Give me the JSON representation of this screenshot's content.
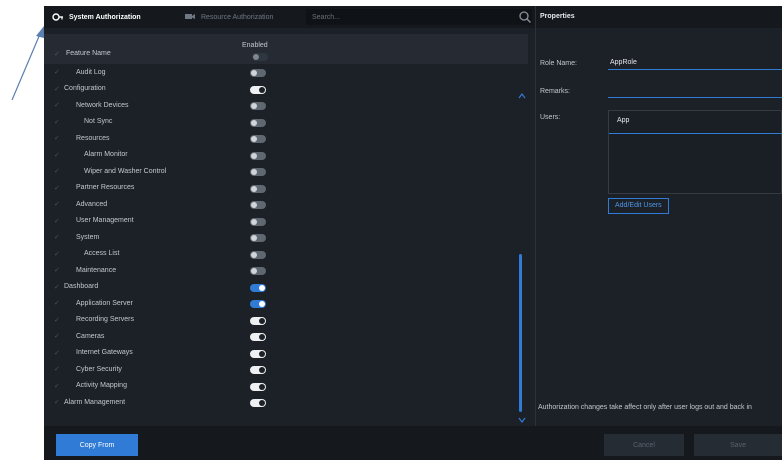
{
  "tabs": [
    {
      "label": "System Authorization",
      "icon": "key-icon",
      "active": true
    },
    {
      "label": "Resource Authorization",
      "icon": "camera-icon",
      "active": false
    }
  ],
  "search": {
    "placeholder": "Search..."
  },
  "table": {
    "header_name": "Feature Name",
    "header_enabled": "Enabled",
    "rows": [
      {
        "label": "Audit Log",
        "level": 1,
        "state": "off"
      },
      {
        "label": "Configuration",
        "level": 0,
        "state": "on-white"
      },
      {
        "label": "Network Devices",
        "level": 1,
        "state": "off"
      },
      {
        "label": "Not Sync",
        "level": 2,
        "state": "off"
      },
      {
        "label": "Resources",
        "level": 1,
        "state": "off"
      },
      {
        "label": "Alarm Monitor",
        "level": 2,
        "state": "off"
      },
      {
        "label": "Wiper and Washer Control",
        "level": 2,
        "state": "off"
      },
      {
        "label": "Partner Resources",
        "level": 1,
        "state": "off"
      },
      {
        "label": "Advanced",
        "level": 1,
        "state": "off"
      },
      {
        "label": "User Management",
        "level": 1,
        "state": "off"
      },
      {
        "label": "System",
        "level": 1,
        "state": "off"
      },
      {
        "label": "Access List",
        "level": 2,
        "state": "off"
      },
      {
        "label": "Maintenance",
        "level": 1,
        "state": "off"
      },
      {
        "label": "Dashboard",
        "level": 0,
        "state": "on-blue"
      },
      {
        "label": "Application Server",
        "level": 1,
        "state": "on-blue"
      },
      {
        "label": "Recording Servers",
        "level": 1,
        "state": "on-white"
      },
      {
        "label": "Cameras",
        "level": 1,
        "state": "on-white"
      },
      {
        "label": "Internet Gateways",
        "level": 1,
        "state": "on-white"
      },
      {
        "label": "Cyber Security",
        "level": 1,
        "state": "on-white"
      },
      {
        "label": "Activity Mapping",
        "level": 1,
        "state": "on-white"
      },
      {
        "label": "Alarm Management",
        "level": 0,
        "state": "on-white"
      }
    ]
  },
  "properties": {
    "title": "Properties",
    "role_name_label": "Role Name:",
    "role_name_value": "AppRole",
    "remarks_label": "Remarks:",
    "remarks_value": "",
    "users_label": "Users:",
    "users": [
      "App"
    ],
    "add_users_label": "Add/Edit Users",
    "notice": "Authorization changes take affect only after user logs out and back in"
  },
  "footer": {
    "copy_from": "Copy From",
    "cancel": "Cancel",
    "save": "Save"
  },
  "colors": {
    "accent": "#2f7bd6",
    "background": "#1c2128",
    "bar": "#15191e"
  }
}
